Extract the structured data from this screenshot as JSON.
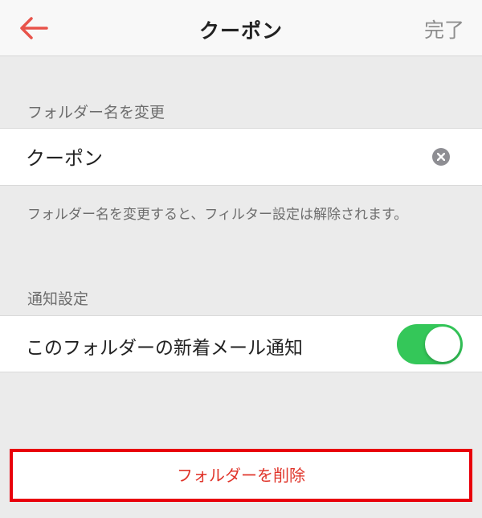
{
  "navbar": {
    "back_icon": "arrow-left-icon",
    "title": "クーポン",
    "done_label": "完了",
    "accent_color": "#e8534a"
  },
  "rename_section": {
    "header": "フォルダー名を変更",
    "input_value": "クーポン",
    "clear_icon": "clear-circle-icon",
    "hint": "フォルダー名を変更すると、フィルター設定は解除されます。"
  },
  "notification_section": {
    "header": "通知設定",
    "row_label": "このフォルダーの新着メール通知",
    "toggle_on": true,
    "toggle_color": "#34c759"
  },
  "delete_button": {
    "label": "フォルダーを削除",
    "text_color": "#e0352b"
  }
}
